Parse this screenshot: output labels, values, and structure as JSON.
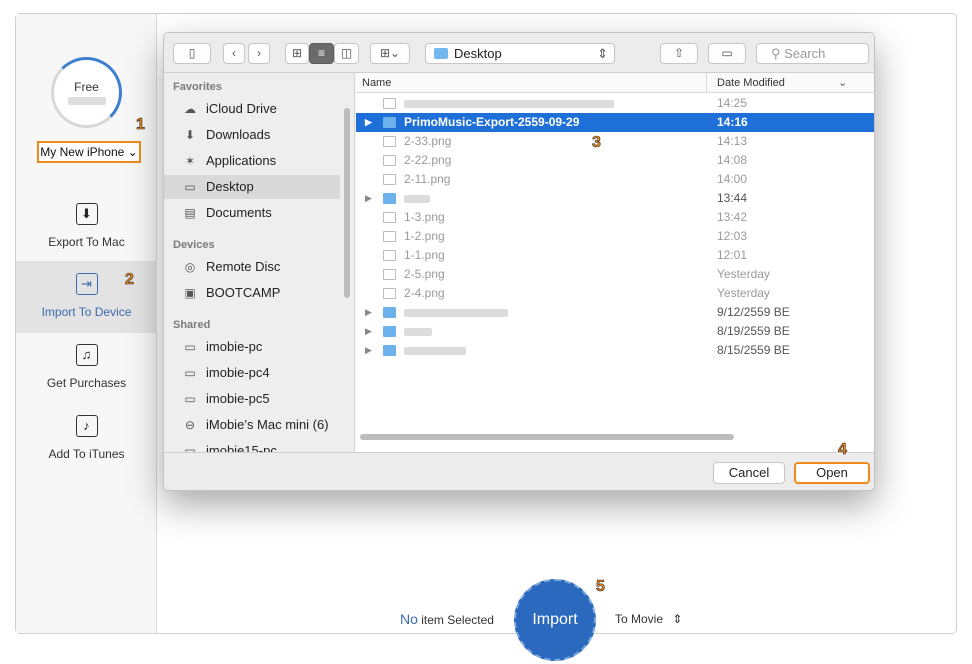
{
  "app": {
    "ring_label": "Free",
    "device_name": "My New iPhone",
    "nav": [
      {
        "label": "Export To Mac",
        "icon": "export-icon",
        "glyph": "⬇"
      },
      {
        "label": "Import To Device",
        "icon": "import-icon",
        "glyph": "⇥"
      },
      {
        "label": "Get Purchases",
        "icon": "purchases-icon",
        "glyph": "♫"
      },
      {
        "label": "Add To iTunes",
        "icon": "itunes-icon",
        "glyph": "♪"
      }
    ],
    "status_count": "No",
    "status_text": "item Selected",
    "import_label": "Import",
    "target_label": "To Movie",
    "step_badges": [
      "1",
      "2",
      "3",
      "4",
      "5"
    ]
  },
  "dialog": {
    "location": "Desktop",
    "search_placeholder": "Search",
    "sidebar": {
      "favorites_heading": "Favorites",
      "favorites": [
        {
          "label": "iCloud Drive",
          "icon": "cloud-icon"
        },
        {
          "label": "Downloads",
          "icon": "downloads-icon"
        },
        {
          "label": "Applications",
          "icon": "applications-icon"
        },
        {
          "label": "Desktop",
          "icon": "desktop-icon"
        },
        {
          "label": "Documents",
          "icon": "documents-icon"
        }
      ],
      "devices_heading": "Devices",
      "devices": [
        {
          "label": "Remote Disc",
          "icon": "disc-icon"
        },
        {
          "label": "BOOTCAMP",
          "icon": "drive-icon"
        }
      ],
      "shared_heading": "Shared",
      "shared": [
        {
          "label": "imobie-pc",
          "icon": "computer-icon"
        },
        {
          "label": "imobie-pc4",
          "icon": "computer-icon"
        },
        {
          "label": "imobie-pc5",
          "icon": "computer-icon"
        },
        {
          "label": "iMobie’s Mac mini (6)",
          "icon": "mac-mini-icon"
        },
        {
          "label": "imobie15-pc",
          "icon": "computer-icon"
        }
      ]
    },
    "columns": {
      "name": "Name",
      "date": "Date Modified"
    },
    "files": [
      {
        "name": "",
        "date": "14:25",
        "kind": "file"
      },
      {
        "name": "PrimoMusic-Export-2559-09-29",
        "date": "14:16",
        "kind": "folder"
      },
      {
        "name": "2-33.png",
        "date": "14:13",
        "kind": "file"
      },
      {
        "name": "2-22.png",
        "date": "14:08",
        "kind": "file"
      },
      {
        "name": "2-11.png",
        "date": "14:00",
        "kind": "file"
      },
      {
        "name": "",
        "date": "13:44",
        "kind": "folder"
      },
      {
        "name": "1-3.png",
        "date": "13:42",
        "kind": "file"
      },
      {
        "name": "1-2.png",
        "date": "12:03",
        "kind": "file"
      },
      {
        "name": "1-1.png",
        "date": "12:01",
        "kind": "file"
      },
      {
        "name": "2-5.png",
        "date": "Yesterday",
        "kind": "file"
      },
      {
        "name": "2-4.png",
        "date": "Yesterday",
        "kind": "file"
      },
      {
        "name": "",
        "date": "9/12/2559 BE",
        "kind": "folder"
      },
      {
        "name": "",
        "date": "8/19/2559 BE",
        "kind": "folder"
      },
      {
        "name": "",
        "date": "8/15/2559 BE",
        "kind": "folder"
      }
    ],
    "cancel_label": "Cancel",
    "open_label": "Open"
  }
}
